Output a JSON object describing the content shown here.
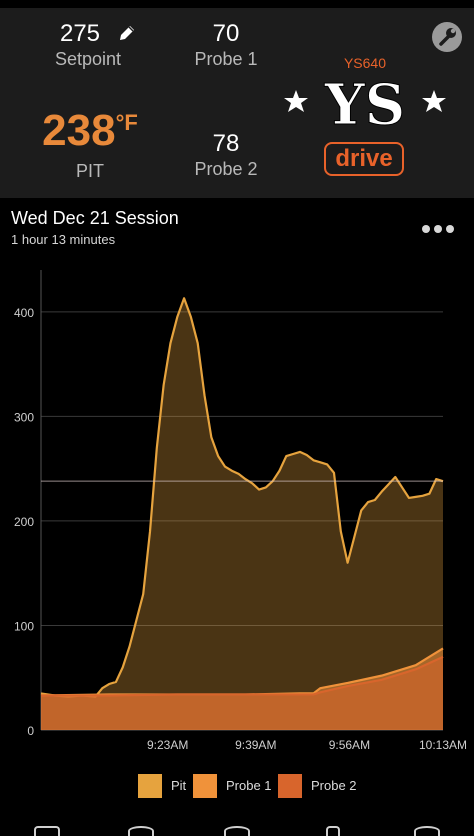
{
  "header": {
    "setpoint": {
      "value": "275",
      "label": "Setpoint"
    },
    "probe1": {
      "value": "70",
      "label": "Probe 1"
    },
    "pit": {
      "value": "238",
      "unit": "°F",
      "label": "PIT"
    },
    "probe2": {
      "value": "78",
      "label": "Probe 2"
    },
    "logo": {
      "model": "YS640",
      "mark": "YS",
      "badge": "drive"
    }
  },
  "session": {
    "title": "Wed Dec 21 Session",
    "duration": "1 hour 13 minutes"
  },
  "colors": {
    "pit": "#e6a33e",
    "probe1": "#f0923a",
    "probe2": "#d8652c",
    "accent": "#e8622a"
  },
  "chart_data": {
    "type": "area",
    "y_ticks": [
      "0",
      "100",
      "200",
      "300",
      "400"
    ],
    "x_ticks": [
      "9:23AM",
      "9:39AM",
      "9:56AM",
      "10:13AM"
    ],
    "x_tick_minutes": [
      23,
      39,
      56,
      73
    ],
    "x_range_minutes": [
      0,
      73
    ],
    "ylim": [
      0,
      440
    ],
    "setpoint_line": 238,
    "series": [
      {
        "name": "Pit",
        "points": [
          [
            0,
            35
          ],
          [
            2,
            33
          ],
          [
            4,
            32
          ],
          [
            6,
            33
          ],
          [
            8,
            32
          ],
          [
            9,
            40
          ],
          [
            10,
            44
          ],
          [
            11,
            46
          ],
          [
            12,
            60
          ],
          [
            13,
            80
          ],
          [
            14,
            105
          ],
          [
            15,
            130
          ],
          [
            16,
            190
          ],
          [
            17,
            270
          ],
          [
            18,
            330
          ],
          [
            19,
            370
          ],
          [
            20,
            395
          ],
          [
            21,
            413
          ],
          [
            22,
            395
          ],
          [
            23,
            370
          ],
          [
            24,
            320
          ],
          [
            25,
            280
          ],
          [
            26,
            262
          ],
          [
            27,
            252
          ],
          [
            28,
            248
          ],
          [
            29,
            245
          ],
          [
            30,
            240
          ],
          [
            31,
            236
          ],
          [
            32,
            230
          ],
          [
            33,
            232
          ],
          [
            34,
            238
          ],
          [
            35,
            248
          ],
          [
            36,
            262
          ],
          [
            37,
            264
          ],
          [
            38,
            266
          ],
          [
            39,
            263
          ],
          [
            40,
            258
          ],
          [
            41,
            256
          ],
          [
            42,
            254
          ],
          [
            43,
            246
          ],
          [
            44,
            190
          ],
          [
            45,
            160
          ],
          [
            46,
            185
          ],
          [
            47,
            210
          ],
          [
            48,
            218
          ],
          [
            49,
            220
          ],
          [
            50,
            228
          ],
          [
            51,
            235
          ],
          [
            52,
            242
          ],
          [
            53,
            232
          ],
          [
            54,
            222
          ],
          [
            55,
            223
          ],
          [
            56,
            224
          ],
          [
            57,
            226
          ],
          [
            58,
            240
          ],
          [
            59,
            238
          ]
        ]
      },
      {
        "name": "Probe 1",
        "points": [
          [
            0,
            33
          ],
          [
            10,
            34
          ],
          [
            20,
            34
          ],
          [
            30,
            34
          ],
          [
            38,
            35
          ],
          [
            40,
            35
          ],
          [
            41,
            40
          ],
          [
            45,
            45
          ],
          [
            50,
            52
          ],
          [
            55,
            62
          ],
          [
            59,
            78
          ]
        ]
      },
      {
        "name": "Probe 2",
        "points": [
          [
            0,
            33
          ],
          [
            10,
            33
          ],
          [
            20,
            34
          ],
          [
            30,
            34
          ],
          [
            38,
            34
          ],
          [
            40,
            34
          ],
          [
            41,
            36
          ],
          [
            45,
            42
          ],
          [
            50,
            48
          ],
          [
            55,
            58
          ],
          [
            59,
            70
          ]
        ]
      }
    ]
  },
  "legend": [
    "Pit",
    "Probe 1",
    "Probe 2"
  ]
}
